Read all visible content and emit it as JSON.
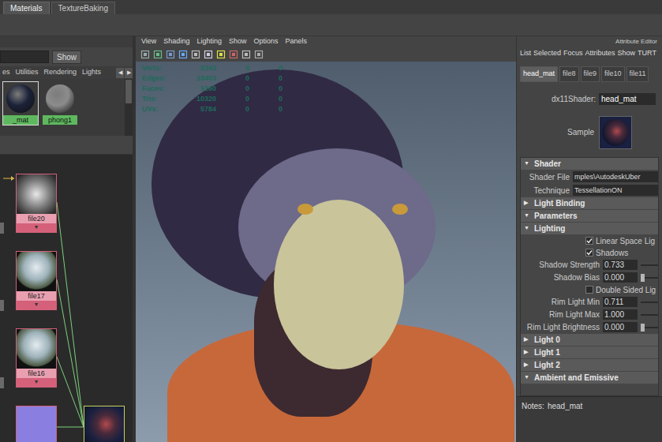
{
  "app_tabs": [
    {
      "label": "Materials",
      "selected": true
    },
    {
      "label": "TextureBaking",
      "selected": false
    }
  ],
  "hypershade": {
    "search": {
      "button": "Show"
    },
    "tabs": [
      {
        "label": "es",
        "selected": false
      },
      {
        "label": "Utilities",
        "selected": false
      },
      {
        "label": "Rendering",
        "selected": false
      },
      {
        "label": "Lights",
        "selected": false
      }
    ],
    "tab_arrows": [
      "◀",
      "▶"
    ],
    "swatches": [
      {
        "label": "_mat",
        "selected": true,
        "color": "#1b2238"
      },
      {
        "label": "phong1",
        "selected": false,
        "color": "#8c8c8c"
      }
    ],
    "node_glyph": "▼",
    "nodes": [
      {
        "label": "file20",
        "kind": "texture"
      },
      {
        "label": "file17",
        "kind": "environment"
      },
      {
        "label": "file16",
        "kind": "environment"
      },
      {
        "kind": "normal"
      },
      {
        "kind": "material"
      }
    ]
  },
  "viewport": {
    "menu": [
      "View",
      "Shading",
      "Lighting",
      "Show",
      "Options",
      "Panels"
    ],
    "hud": [
      {
        "label": "Verts:",
        "values": [
          "5243",
          "0",
          "0"
        ]
      },
      {
        "label": "Edges:",
        "values": [
          "10403",
          "0",
          "0"
        ]
      },
      {
        "label": "Faces:",
        "values": [
          "5160",
          "0",
          "0"
        ]
      },
      {
        "label": "Tris:",
        "values": [
          "10320",
          "0",
          "0"
        ]
      },
      {
        "label": "UVs:",
        "values": [
          "5784",
          "0",
          "0"
        ]
      }
    ]
  },
  "attribute_editor": {
    "title": "Attribute Editor",
    "menu": [
      "List",
      "Selected",
      "Focus",
      "Attributes",
      "Show",
      "TURT"
    ],
    "tabs": [
      {
        "label": "head_mat",
        "selected": true
      },
      {
        "label": "file8",
        "selected": false
      },
      {
        "label": "file9",
        "selected": false
      },
      {
        "label": "file10",
        "selected": false
      },
      {
        "label": "file11",
        "selected": false
      }
    ],
    "shader": {
      "label": "dx11Shader:",
      "value": "head_mat"
    },
    "sample": {
      "label": "Sample"
    },
    "glyphs": {
      "expanded": "▼",
      "collapsed": "▶"
    },
    "rows": [
      {
        "kind": "section",
        "label": "Shader",
        "expanded": true
      },
      {
        "kind": "field",
        "label": "Shader File",
        "value": "mples\\AutodeskUber"
      },
      {
        "kind": "field",
        "label": "Technique",
        "value": "TessellationON"
      },
      {
        "kind": "section",
        "label": "Light Binding",
        "expanded": false
      },
      {
        "kind": "section",
        "label": "Parameters",
        "expanded": true
      },
      {
        "kind": "section",
        "label": "Lighting",
        "expanded": true
      },
      {
        "kind": "checkbox",
        "label": "Linear Space Lig",
        "checked": true
      },
      {
        "kind": "checkbox",
        "label": "Shadows",
        "checked": true
      },
      {
        "kind": "number",
        "label": "Shadow Strength",
        "value": "0.733",
        "level": 0.733
      },
      {
        "kind": "number",
        "label": "Shadow Bias",
        "value": "0.000",
        "level": 0
      },
      {
        "kind": "checkbox",
        "label": "Double Sided Lig",
        "checked": false
      },
      {
        "kind": "number",
        "label": "Rim Light Min",
        "value": "0.711",
        "level": 0.711
      },
      {
        "kind": "number",
        "label": "Rim Light Max",
        "value": "1.000",
        "level": 1
      },
      {
        "kind": "number",
        "label": "Rim Light Brightness",
        "value": "0.000",
        "level": 0
      },
      {
        "kind": "section",
        "label": "Light 0",
        "expanded": false
      },
      {
        "kind": "section",
        "label": "Light 1",
        "expanded": false
      },
      {
        "kind": "section",
        "label": "Light 2",
        "expanded": false
      },
      {
        "kind": "section",
        "label": "Ambient and Emissive",
        "expanded": true
      }
    ],
    "notes": {
      "label": "Notes:",
      "value": "head_mat"
    }
  }
}
